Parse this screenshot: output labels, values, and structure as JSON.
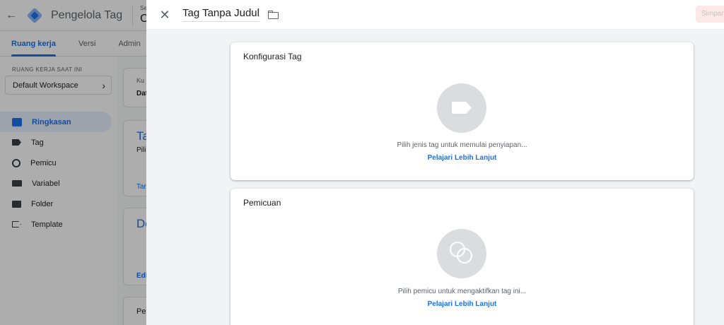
{
  "app": {
    "title": "Pengelola Tag",
    "account_small": "Semua akun",
    "account_name": "Op"
  },
  "nav_tabs": [
    {
      "label": "Ruang kerja",
      "active": true
    },
    {
      "label": "Versi",
      "active": false
    },
    {
      "label": "Admin",
      "active": false
    }
  ],
  "sidebar": {
    "workspace_label": "RUANG KERJA SAAT INI",
    "workspace_name": "Default Workspace",
    "items": [
      {
        "label": "Ringkasan",
        "icon": "summary-icon",
        "active": true
      },
      {
        "label": "Tag",
        "icon": "tag-icon",
        "active": false
      },
      {
        "label": "Pemicu",
        "icon": "trigger-icon",
        "active": false
      },
      {
        "label": "Variabel",
        "icon": "variable-icon",
        "active": false
      },
      {
        "label": "Folder",
        "icon": "folder-icon",
        "active": false
      },
      {
        "label": "Template",
        "icon": "template-icon",
        "active": false
      }
    ]
  },
  "bg_cards": {
    "c1_line1": "Ku",
    "c1_line2": "Dat",
    "c2_title": "Ta",
    "c2_sub": "Pili",
    "c2_link": "Tar",
    "c3_title": "De",
    "c3_link": "Edi",
    "c4_title": "Pe"
  },
  "editor": {
    "tag_name": "Tag Tanpa Judul",
    "save_label": "Simpan",
    "tag_config": {
      "title": "Konfigurasi Tag",
      "hint": "Pilih jenis tag untuk memulai penyiapan...",
      "link": "Pelajari Lebih Lanjut"
    },
    "triggering": {
      "title": "Pemicuan",
      "hint": "Pilih pemicu untuk mengaktifkan tag ini...",
      "link": "Pelajari Lebih Lanjut"
    }
  },
  "colors": {
    "accent": "#1a73e8",
    "overlay": "rgba(0,0,0,0.32)",
    "placeholder_circle": "#dadce0"
  }
}
